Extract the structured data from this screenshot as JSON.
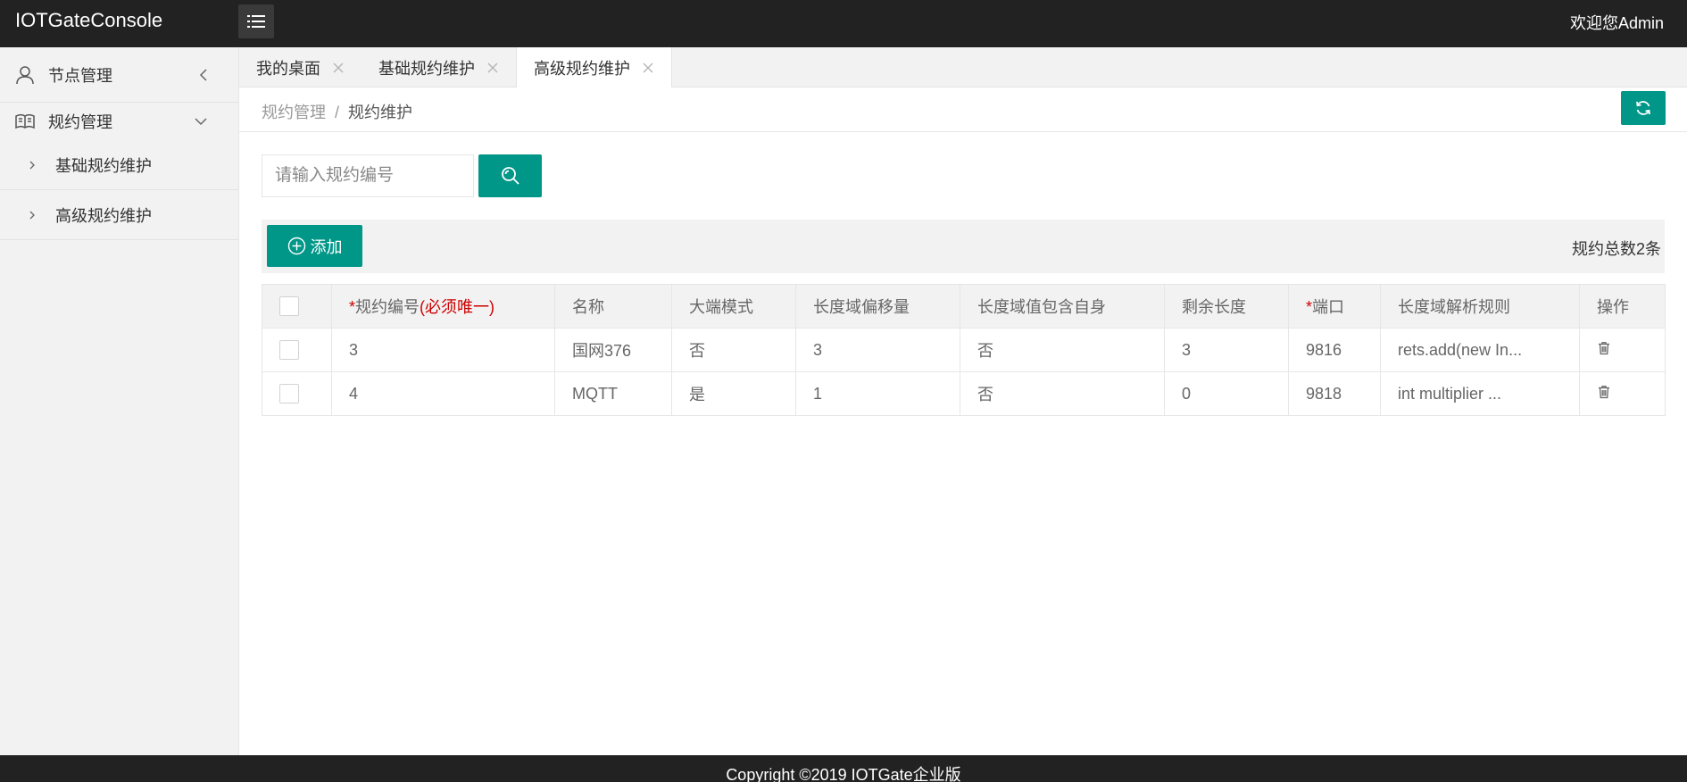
{
  "header": {
    "logo": "IOTGateConsole",
    "welcome": "欢迎您Admin"
  },
  "sidebar": {
    "groups": [
      {
        "label": "节点管理",
        "icon": "user-icon",
        "state": "collapsed"
      },
      {
        "label": "规约管理",
        "icon": "book-icon",
        "state": "expanded"
      }
    ],
    "sub_items": [
      {
        "label": "基础规约维护"
      },
      {
        "label": "高级规约维护"
      }
    ]
  },
  "tabs": [
    {
      "label": "我的桌面",
      "active": false
    },
    {
      "label": "基础规约维护",
      "active": false
    },
    {
      "label": "高级规约维护",
      "active": true
    }
  ],
  "breadcrumb": {
    "parent": "规约管理",
    "separator": "/",
    "current": "规约维护"
  },
  "search": {
    "placeholder": "请输入规约编号"
  },
  "toolbar": {
    "add_label": "添加",
    "total_text": "规约总数2条"
  },
  "table": {
    "columns": {
      "id_label": "规约编号",
      "id_note": "(必须唯一)",
      "name": "名称",
      "big_endian": "大端模式",
      "len_offset": "长度域偏移量",
      "len_include_self": "长度域值包含自身",
      "remain_len": "剩余长度",
      "port_label": "端口",
      "len_rule": "长度域解析规则",
      "action": "操作"
    },
    "required_mark": "*",
    "rows": [
      {
        "id": "3",
        "name": "国网376",
        "big_endian": "否",
        "len_offset": "3",
        "len_include_self": "否",
        "remain_len": "3",
        "port": "9816",
        "len_rule": "rets.add(new In..."
      },
      {
        "id": "4",
        "name": "MQTT",
        "big_endian": "是",
        "len_offset": "1",
        "len_include_self": "否",
        "remain_len": "0",
        "port": "9818",
        "len_rule": "int multiplier ..."
      }
    ]
  },
  "footer": {
    "copyright": "Copyright ©2019 IOTGate企业版"
  },
  "colors": {
    "primary": "#009688",
    "header_bg": "#222222",
    "required": "#cc0000"
  }
}
